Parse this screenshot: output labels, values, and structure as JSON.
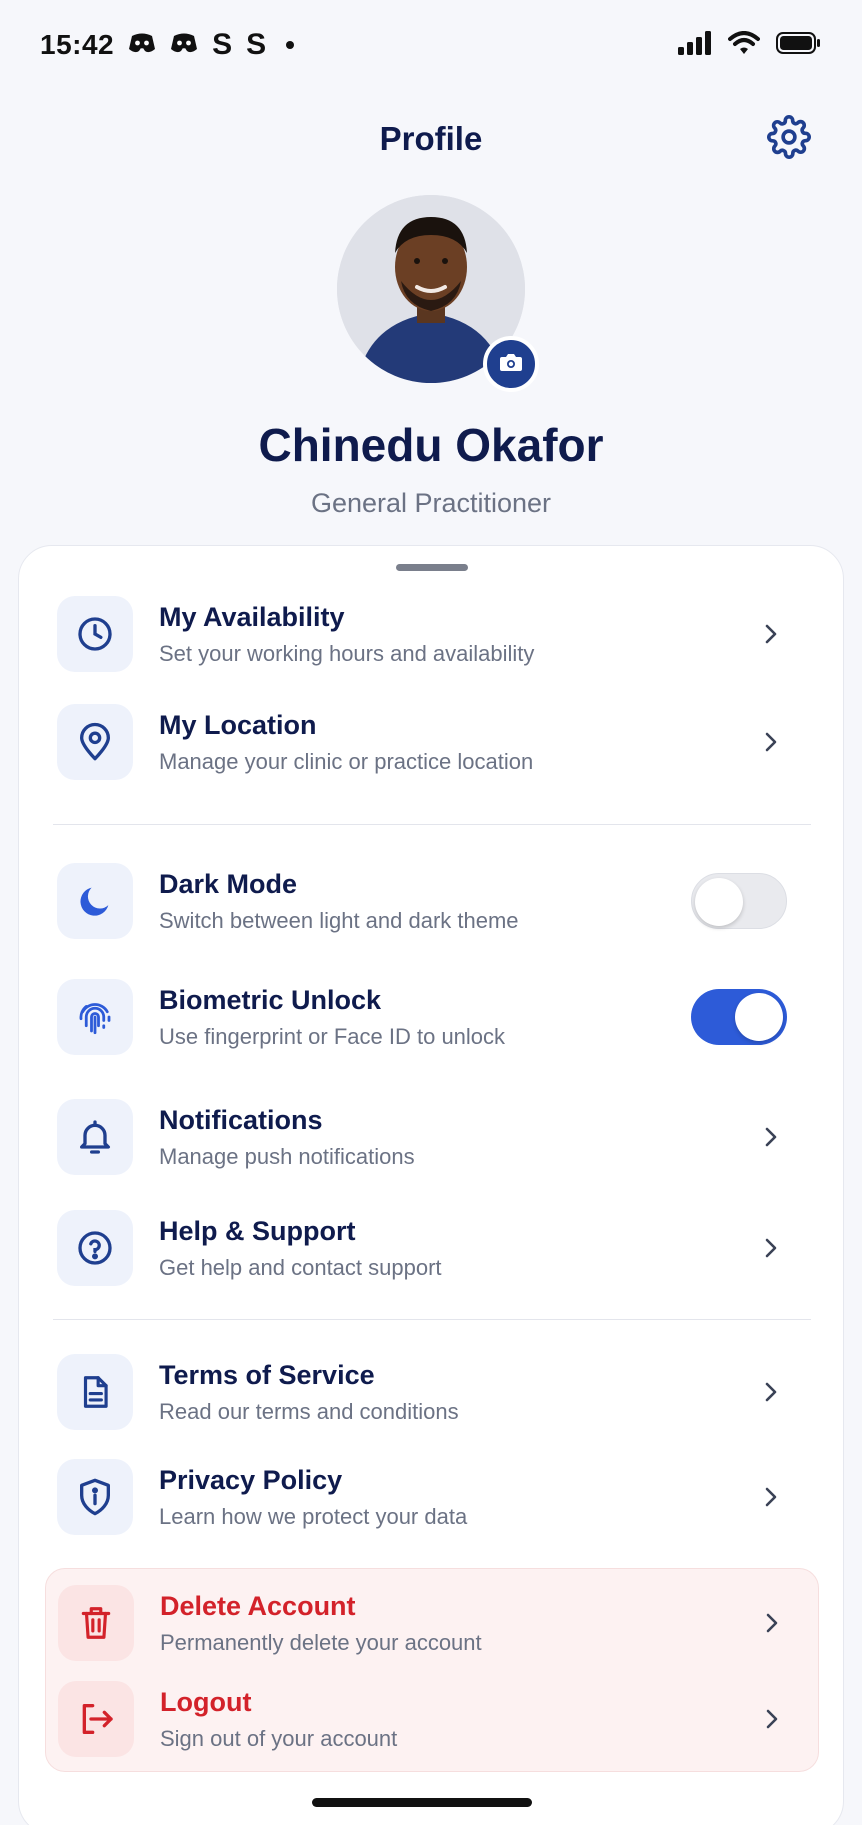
{
  "status_bar": {
    "time": "15:42",
    "notification_icons": [
      "discord-icon",
      "discord-icon",
      "S",
      "S"
    ]
  },
  "header": {
    "title": "Profile",
    "settings_icon": "gear-icon"
  },
  "profile": {
    "name": "Chinedu Okafor",
    "role": "General Practitioner",
    "camera_icon": "camera-icon"
  },
  "menu": {
    "availability": {
      "title": "My Availability",
      "subtitle": "Set your working hours and availability",
      "icon": "clock-icon"
    },
    "location": {
      "title": "My Location",
      "subtitle": "Manage your clinic or practice location",
      "icon": "location-pin-icon"
    },
    "dark_mode": {
      "title": "Dark Mode",
      "subtitle": "Switch between light and dark theme",
      "icon": "moon-icon",
      "enabled": false
    },
    "biometric": {
      "title": "Biometric Unlock",
      "subtitle": "Use fingerprint or Face ID to unlock",
      "icon": "fingerprint-icon",
      "enabled": true
    },
    "notifications": {
      "title": "Notifications",
      "subtitle": "Manage push notifications",
      "icon": "bell-icon"
    },
    "help": {
      "title": "Help & Support",
      "subtitle": "Get help and contact support",
      "icon": "question-icon"
    },
    "terms": {
      "title": "Terms of Service",
      "subtitle": "Read our terms and conditions",
      "icon": "document-icon"
    },
    "privacy": {
      "title": "Privacy Policy",
      "subtitle": "Learn how we protect your data",
      "icon": "shield-icon"
    },
    "delete_account": {
      "title": "Delete Account",
      "subtitle": "Permanently delete your account",
      "icon": "trash-icon"
    },
    "logout": {
      "title": "Logout",
      "subtitle": "Sign out of your account",
      "icon": "logout-icon"
    }
  },
  "colors": {
    "primary": "#2d5bd8",
    "navy": "#0f1b4d",
    "danger": "#d3222a",
    "muted": "#6b7284"
  }
}
